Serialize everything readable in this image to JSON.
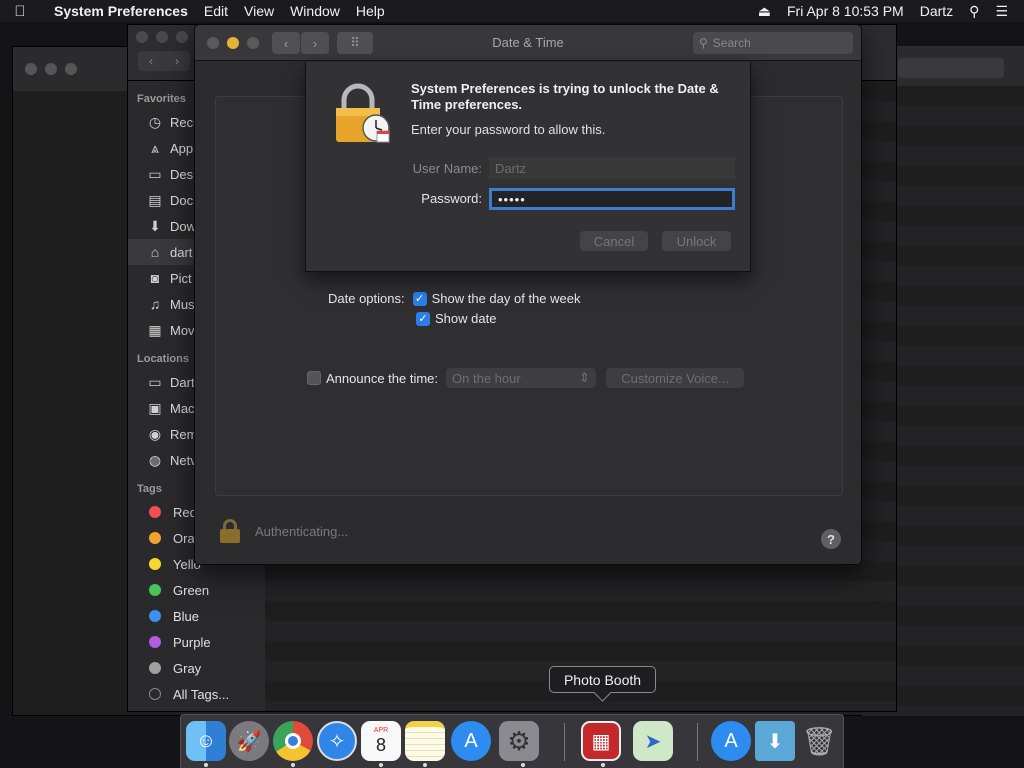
{
  "menubar": {
    "apple": "",
    "app_name": "System Preferences",
    "menus": [
      "Edit",
      "View",
      "Window",
      "Help"
    ],
    "datetime": "Fri Apr 8  10:53 PM",
    "user": "Dartz"
  },
  "finder": {
    "favorites_header": "Favorites",
    "favorites": [
      "Rece",
      "App",
      "Des",
      "Doc",
      "Dow",
      "dart",
      "Pict",
      "Mus",
      "Mov"
    ],
    "locations_header": "Locations",
    "locations": [
      "Dart",
      "Mac",
      "Rem",
      "Netv"
    ],
    "tags_header": "Tags",
    "tags": [
      {
        "label": "Red",
        "color": "#f0504f"
      },
      {
        "label": "Oran",
        "color": "#f3a32d"
      },
      {
        "label": "Yello",
        "color": "#f7d92d"
      },
      {
        "label": "Green",
        "color": "#46c35a"
      },
      {
        "label": "Blue",
        "color": "#3d8ff0"
      },
      {
        "label": "Purple",
        "color": "#b25be0"
      },
      {
        "label": "Gray",
        "color": "#a0a0a0"
      }
    ],
    "all_tags": "All Tags..."
  },
  "datetime_window": {
    "title": "Date & Time",
    "search_placeholder": "Search",
    "date_options_label": "Date options:",
    "show_day_of_week": "Show the day of the week",
    "show_date": "Show date",
    "announce_label": "Announce the time:",
    "announce_value": "On the hour",
    "customize_voice": "Customize Voice...",
    "status": "Authenticating..."
  },
  "auth_sheet": {
    "heading": "System Preferences is trying to unlock the Date & Time preferences.",
    "subtext": "Enter your password to allow this.",
    "username_label": "User Name:",
    "username_value": "Dartz",
    "password_label": "Password:",
    "password_value": "•••••",
    "cancel": "Cancel",
    "unlock": "Unlock"
  },
  "dock": {
    "tooltip": "Photo Booth"
  }
}
